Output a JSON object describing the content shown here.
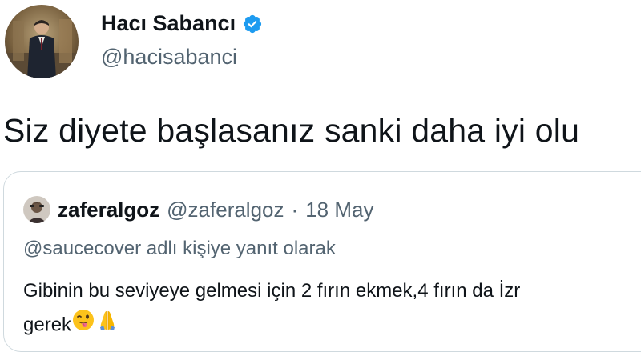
{
  "author": {
    "display_name": "Hacı Sabancı",
    "handle": "@hacisabanci",
    "verified_icon": "verified-badge-icon",
    "badge_color": "#1d9bf0"
  },
  "tweet": {
    "text": "Siz diyete başlasanız sanki daha iyi olu"
  },
  "quoted_tweet": {
    "author_name": "zaferalgoz",
    "author_handle": "@zaferalgoz",
    "separator": "·",
    "date": "18 May",
    "replying_to": "@saucecover adlı kişiye yanıt olarak",
    "body_line1": "Gibinin bu seviyeye gelmesi için 2 fırın ekmek,4 fırın da İzr",
    "body_line2": "gerek",
    "emojis": [
      "winking-face-with-tongue-icon",
      "folded-hands-icon"
    ]
  },
  "colors": {
    "text_primary": "#0f1419",
    "text_secondary": "#536471",
    "border": "#cfd9de"
  }
}
